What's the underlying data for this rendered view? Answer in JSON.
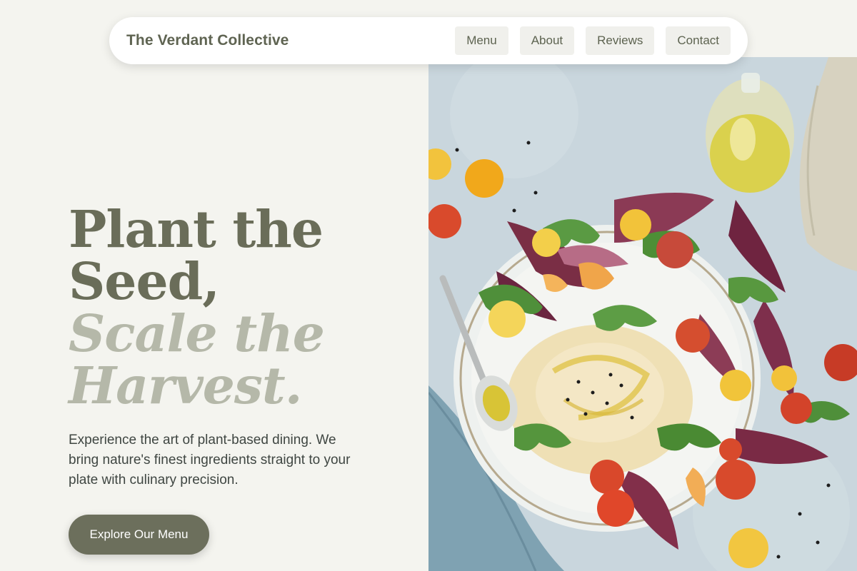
{
  "brand": "The Verdant Collective",
  "nav": {
    "items": [
      {
        "label": "Menu"
      },
      {
        "label": "About"
      },
      {
        "label": "Reviews"
      },
      {
        "label": "Contact"
      }
    ]
  },
  "hero": {
    "headline_line1": "Plant the",
    "headline_line2": "Seed,",
    "headline_accent_line1": "Scale the",
    "headline_accent_line2": "Harvest.",
    "description": "Experience the art of plant-based dining. We bring nature's finest ingredients straight to your plate with culinary precision.",
    "cta_label": "Explore Our Menu"
  },
  "image": {
    "icon": "food-plate-photo"
  },
  "colors": {
    "background": "#f4f4ef",
    "brand_olive": "#6a6d59",
    "accent_sage": "#b5b8a9",
    "button": "#6c6f5c"
  }
}
